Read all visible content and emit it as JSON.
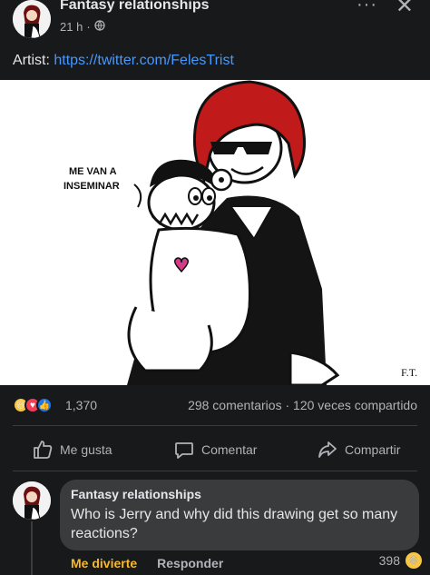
{
  "post": {
    "page_name": "Fantasy relationships",
    "time": "21 h",
    "more_label": "···",
    "close_label": "✕",
    "caption_prefix": "Artist: ",
    "caption_link": "https://twitter.com/FelesTrist"
  },
  "artwork": {
    "speech_line_1": "ME VAN A",
    "speech_line_2": "INSEMINAR",
    "signature": "F.T."
  },
  "stats": {
    "reaction_count": "1,370",
    "comments": "298 comentarios",
    "separator": "·",
    "shares": "120 veces compartido"
  },
  "actions": {
    "like": "Me gusta",
    "comment": "Comentar",
    "share": "Compartir"
  },
  "comment": {
    "author": "Fantasy relationships",
    "text": "Who is Jerry and why did this drawing get so many reactions?",
    "reaction_label": "Me divierte",
    "reply_label": "Responder",
    "reaction_count": "398"
  },
  "colors": {
    "background": "#18191a",
    "link": "#4599ff",
    "haha_reaction": "#f7b928",
    "bubble": "#3a3b3c"
  }
}
